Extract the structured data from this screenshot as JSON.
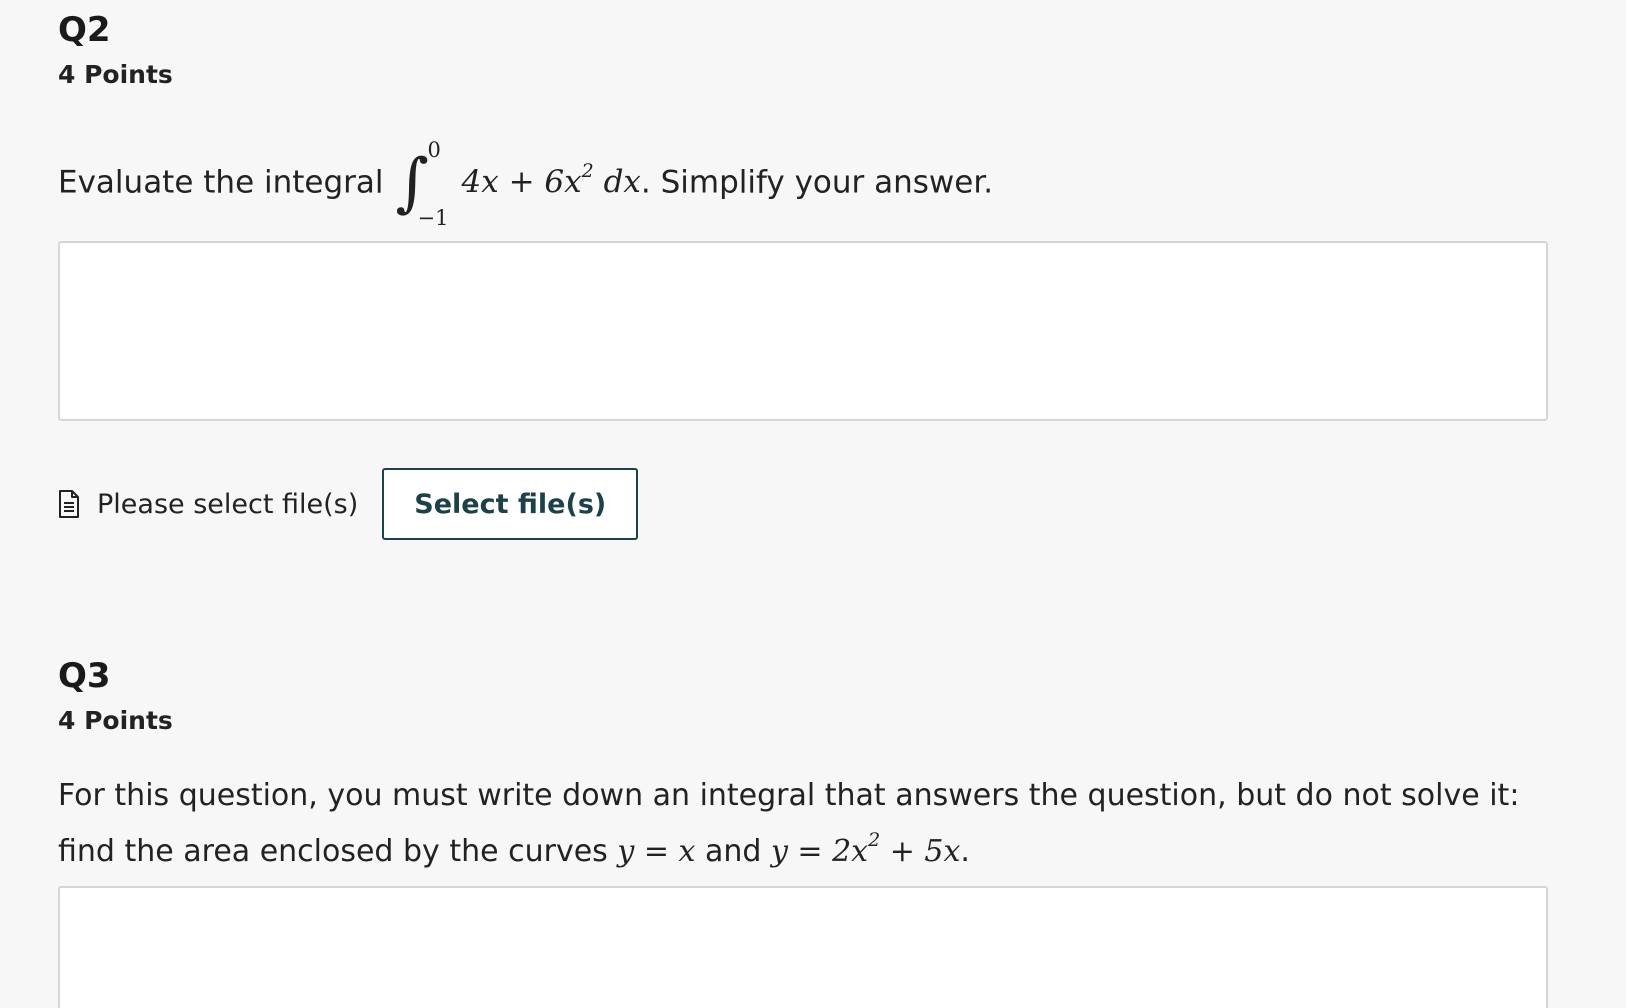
{
  "q2": {
    "title": "Q2",
    "points": "4 Points",
    "prompt_before": "Evaluate the integral",
    "integral_upper": "0",
    "integral_lower": "−1",
    "integrand_a": "4x + 6x",
    "integrand_exp": "2",
    "integrand_b": " dx",
    "prompt_after": ". Simplify your answer.",
    "answer_value": "",
    "file_status": "Please select file(s)",
    "select_button": "Select file(s)"
  },
  "q3": {
    "title": "Q3",
    "points": "4 Points",
    "line1": "For this question, you must write down an integral that answers the question, but do not solve it:",
    "line2_text": "find the area enclosed by the curves ",
    "eq1": "y = x",
    "and_word": " and ",
    "eq2_a": "y = 2x",
    "eq2_exp": "2",
    "eq2_b": " + 5x",
    "end_period": ".",
    "answer_value": ""
  },
  "icons": {
    "file": "document-icon"
  },
  "colors": {
    "background": "#f7f7f7",
    "button_border": "#1d4049",
    "button_text": "#1d4049",
    "box_border": "#d5d5d5"
  }
}
